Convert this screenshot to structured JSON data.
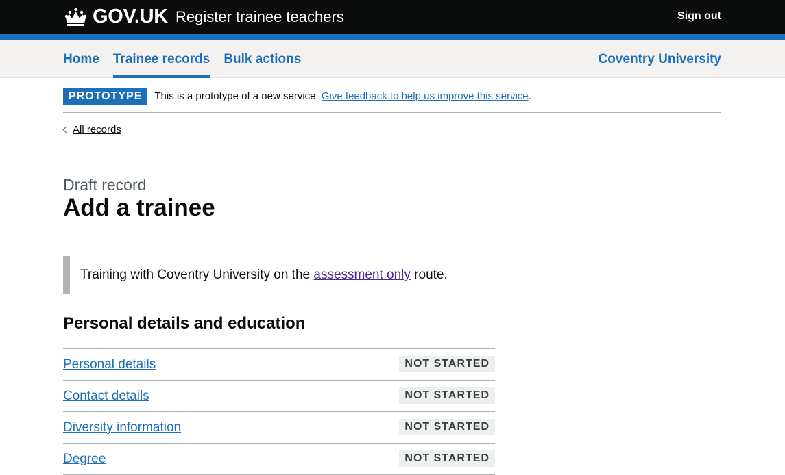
{
  "header": {
    "logo_text": "GOV.UK",
    "service_name": "Register trainee teachers",
    "sign_out_label": "Sign out"
  },
  "nav": {
    "items": [
      {
        "label": "Home",
        "active": false
      },
      {
        "label": "Trainee records",
        "active": true
      },
      {
        "label": "Bulk actions",
        "active": false
      }
    ],
    "organisation": "Coventry University"
  },
  "phase_banner": {
    "tag": "PROTOTYPE",
    "text_before": "This is a prototype of a new service. ",
    "feedback_link": "Give feedback to help us improve this service",
    "text_after": "."
  },
  "back_link": "All records",
  "caption": "Draft record",
  "title": "Add a trainee",
  "inset": {
    "text_before": "Training with Coventry University on the ",
    "link": "assessment only",
    "text_after": " route."
  },
  "section_heading": "Personal details and education",
  "tasks": [
    {
      "label": "Personal details",
      "status": "NOT STARTED"
    },
    {
      "label": "Contact details",
      "status": "NOT STARTED"
    },
    {
      "label": "Diversity information",
      "status": "NOT STARTED"
    },
    {
      "label": "Degree",
      "status": "NOT STARTED"
    }
  ],
  "colors": {
    "header_bg": "#0b0c0c",
    "brand_blue": "#1d70b8",
    "link_visited": "#4c2c92",
    "nav_bg": "#f3f2f1",
    "tag_grey_bg": "#eeefef"
  }
}
